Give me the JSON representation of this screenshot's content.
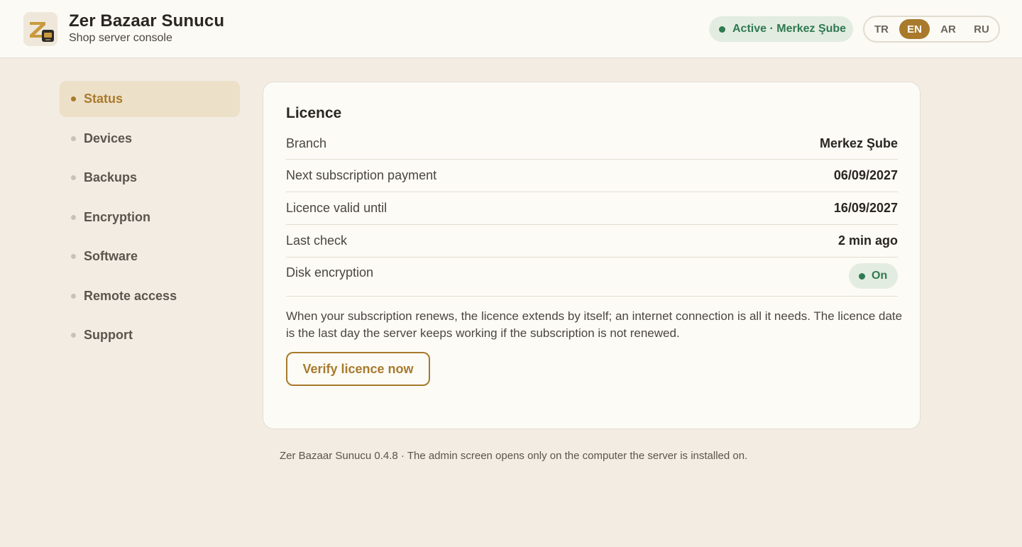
{
  "header": {
    "app_title": "Zer Bazaar Sunucu",
    "app_subtitle": "Shop server console",
    "status": "Active · Merkez Şube",
    "languages": [
      {
        "code": "TR",
        "active": false
      },
      {
        "code": "EN",
        "active": true
      },
      {
        "code": "AR",
        "active": false
      },
      {
        "code": "RU",
        "active": false
      }
    ]
  },
  "sidebar": {
    "items": [
      {
        "label": "Status",
        "active": true
      },
      {
        "label": "Devices",
        "active": false
      },
      {
        "label": "Backups",
        "active": false
      },
      {
        "label": "Encryption",
        "active": false
      },
      {
        "label": "Software",
        "active": false
      },
      {
        "label": "Remote access",
        "active": false
      },
      {
        "label": "Support",
        "active": false
      }
    ]
  },
  "licence": {
    "title": "Licence",
    "rows": [
      {
        "label": "Branch",
        "value": "Merkez Şube"
      },
      {
        "label": "Next subscription payment",
        "value": "06/09/2027"
      },
      {
        "label": "Licence valid until",
        "value": "16/09/2027"
      },
      {
        "label": "Last check",
        "value": "2 min ago"
      }
    ],
    "disk_encryption_label": "Disk encryption",
    "disk_encryption_value": "On",
    "note": "When your subscription renews, the licence extends by itself; an internet connection is all it needs. The licence date is the last day the server keeps working if the subscription is not renewed.",
    "verify_button": "Verify licence now"
  },
  "footer": "Zer Bazaar Sunucu 0.4.8 · The admin screen opens only on the computer the server is installed on.",
  "colors": {
    "accent": "#a87a2c",
    "success": "#2f7a52",
    "background": "#f2ece3",
    "card": "#fcfbf6"
  },
  "icons": {
    "logo": "app-logo-icon",
    "status_dot": "status-dot-icon",
    "nav_bullet": "nav-bullet-icon"
  }
}
